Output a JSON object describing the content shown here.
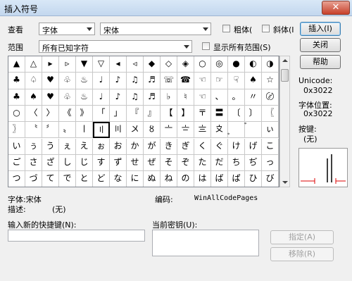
{
  "window": {
    "title": "插入符号",
    "close_glyph": "✕"
  },
  "toolbar": {
    "view_label": "查看",
    "view_value": "字体",
    "font_value": "宋体",
    "bold_label": "粗体(",
    "italic_label": "斜体(I",
    "insert_button": "插入(I)",
    "range_label": "范围",
    "range_value": "所有已知字符",
    "show_all_label": "显示所有范围(S)",
    "close_button": "关闭",
    "help_button": "帮助"
  },
  "grid": {
    "rows": [
      [
        "▲",
        "△",
        "▸",
        "▹",
        "▼",
        "▽",
        "◂",
        "◃",
        "◆",
        "◇",
        "◈",
        "○",
        "◎",
        "●",
        "◐",
        "◑"
      ],
      [
        "♣",
        "♤",
        "♥",
        "♧",
        "♨",
        "♩",
        "♪",
        "♫",
        "♬",
        "☏",
        "☎",
        "☜",
        "☞",
        "☟",
        "♠",
        "☆"
      ],
      [
        "♣",
        "♠",
        "♥",
        "♧",
        "♨",
        "♩",
        "♪",
        "♫",
        "♬",
        "♭",
        "♮",
        "☜",
        "、",
        "。",
        "〃",
        "〄"
      ],
      [
        "○",
        "〈",
        "〉",
        "《",
        "》",
        "「",
        "」",
        "『",
        "』",
        "【",
        "】",
        "〒",
        "〓",
        "〔",
        "〕",
        "〖"
      ],
      [
        "〗",
        "〝",
        "〞",
        "〟",
        "〡",
        "〢",
        "〣",
        "〤",
        "〥",
        "〦",
        "〧",
        "〨",
        "〩",
        "〪",
        "〫",
        "ぃ"
      ],
      [
        "い",
        "ぅ",
        "う",
        "ぇ",
        "え",
        "ぉ",
        "お",
        "か",
        "が",
        "き",
        "ぎ",
        "く",
        "ぐ",
        "け",
        "げ",
        "こ"
      ],
      [
        "ご",
        "さ",
        "ざ",
        "し",
        "じ",
        "す",
        "ず",
        "せ",
        "ぜ",
        "そ",
        "ぞ",
        "た",
        "だ",
        "ち",
        "ぢ",
        "っ"
      ],
      [
        "つ",
        "づ",
        "て",
        "で",
        "と",
        "ど",
        "な",
        "に",
        "ぬ",
        "ね",
        "の",
        "は",
        "ば",
        "ぱ",
        "ひ",
        "び"
      ]
    ],
    "selected": {
      "row": 4,
      "col": 5
    }
  },
  "side": {
    "unicode_label": "Unicode:",
    "unicode_value": "0x3022",
    "pos_label": "字体位置:",
    "pos_value": "0x3022",
    "key_label": "按键:",
    "key_value": "(无)"
  },
  "details": {
    "font_line": "字体:宋体",
    "encoding_label": "编码:",
    "encoding_value": "WinAllCodePages",
    "desc_label": "描述:",
    "desc_value": "(无)"
  },
  "shortcut": {
    "new_label": "输入新的快捷键(N):",
    "new_value": "",
    "current_label": "当前密钥(U):",
    "assign_button": "指定(A)",
    "remove_button": "移除(R)"
  }
}
